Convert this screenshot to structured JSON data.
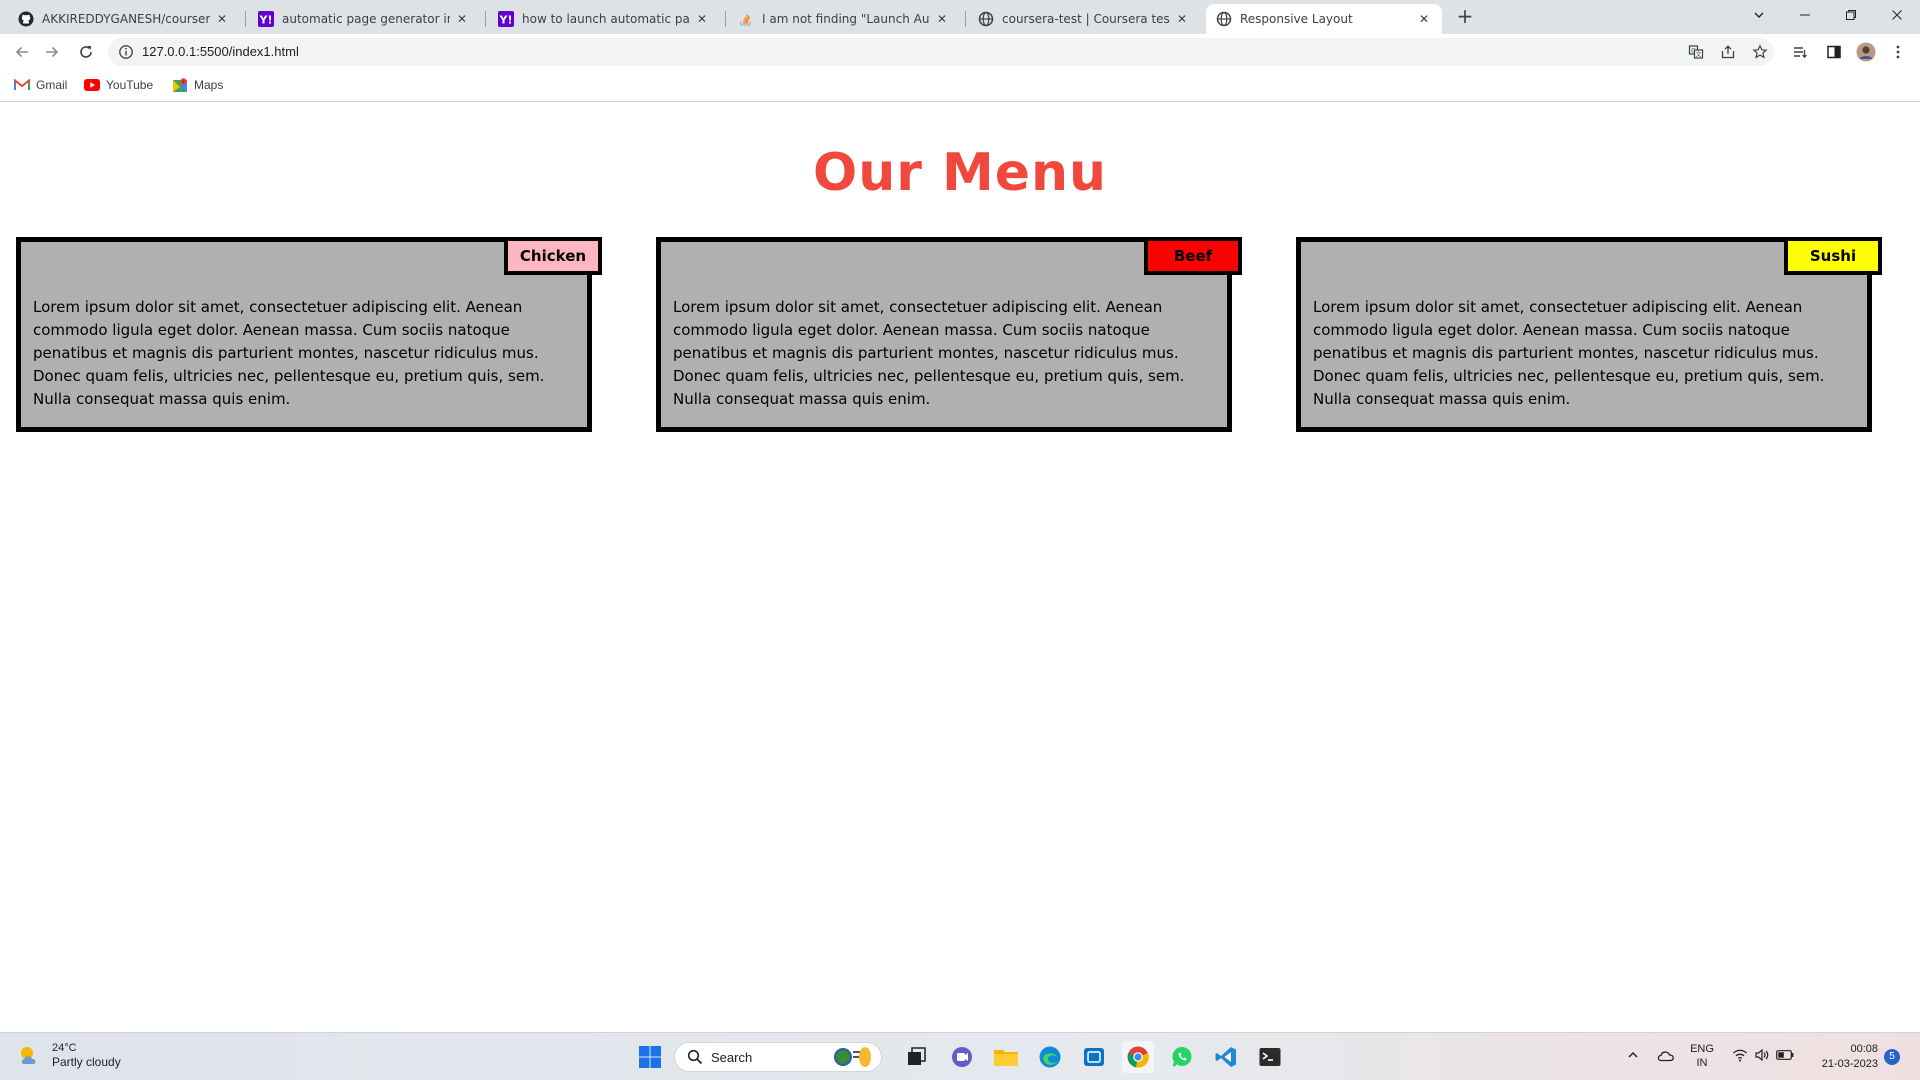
{
  "browser": {
    "tabs": [
      {
        "title": "AKKIREDDYGANESH/coursera-te",
        "icon": "github-icon"
      },
      {
        "title": "automatic page generator in gith",
        "icon": "yahoo-icon"
      },
      {
        "title": "how to launch automatic page ge",
        "icon": "yahoo-icon"
      },
      {
        "title": "I am not finding \"Launch Automa",
        "icon": "stackoverflow-icon"
      },
      {
        "title": "coursera-test | Coursera test repo",
        "icon": "globe-icon"
      },
      {
        "title": "Responsive Layout",
        "icon": "globe-icon"
      }
    ],
    "url": "127.0.0.1:5500/index1.html",
    "bookmarks": [
      {
        "label": "Gmail",
        "icon": "gmail-icon"
      },
      {
        "label": "YouTube",
        "icon": "youtube-icon"
      },
      {
        "label": "Maps",
        "icon": "maps-icon"
      }
    ]
  },
  "page": {
    "title": "Our Menu",
    "cards": [
      {
        "badge": "Chicken",
        "badge_color": "#ffb6c1",
        "text": "Lorem ipsum dolor sit amet, consectetuer adipiscing elit. Aenean commodo ligula eget dolor. Aenean massa. Cum sociis natoque penatibus et magnis dis parturient montes, nascetur ridiculus mus. Donec quam felis, ultricies nec, pellentesque eu, pretium quis, sem. Nulla consequat massa quis enim."
      },
      {
        "badge": "Beef",
        "badge_color": "#ff0000",
        "text": "Lorem ipsum dolor sit amet, consectetuer adipiscing elit. Aenean commodo ligula eget dolor. Aenean massa. Cum sociis natoque penatibus et magnis dis parturient montes, nascetur ridiculus mus. Donec quam felis, ultricies nec, pellentesque eu, pretium quis, sem. Nulla consequat massa quis enim."
      },
      {
        "badge": "Sushi",
        "badge_color": "#ffff00",
        "text": "Lorem ipsum dolor sit amet, consectetuer adipiscing elit. Aenean commodo ligula eget dolor. Aenean massa. Cum sociis natoque penatibus et magnis dis parturient montes, nascetur ridiculus mus. Donec quam felis, ultricies nec, pellentesque eu, pretium quis, sem. Nulla consequat massa quis enim."
      }
    ],
    "title_color": "#f0483c",
    "card_bg": "#b0b0b0"
  },
  "taskbar": {
    "weather_temp": "24°C",
    "weather_cond": "Partly cloudy",
    "search_placeholder": "Search",
    "lang_top": "ENG",
    "lang_bottom": "IN",
    "time": "00:08",
    "date": "21-03-2023",
    "notification_count": "5"
  }
}
